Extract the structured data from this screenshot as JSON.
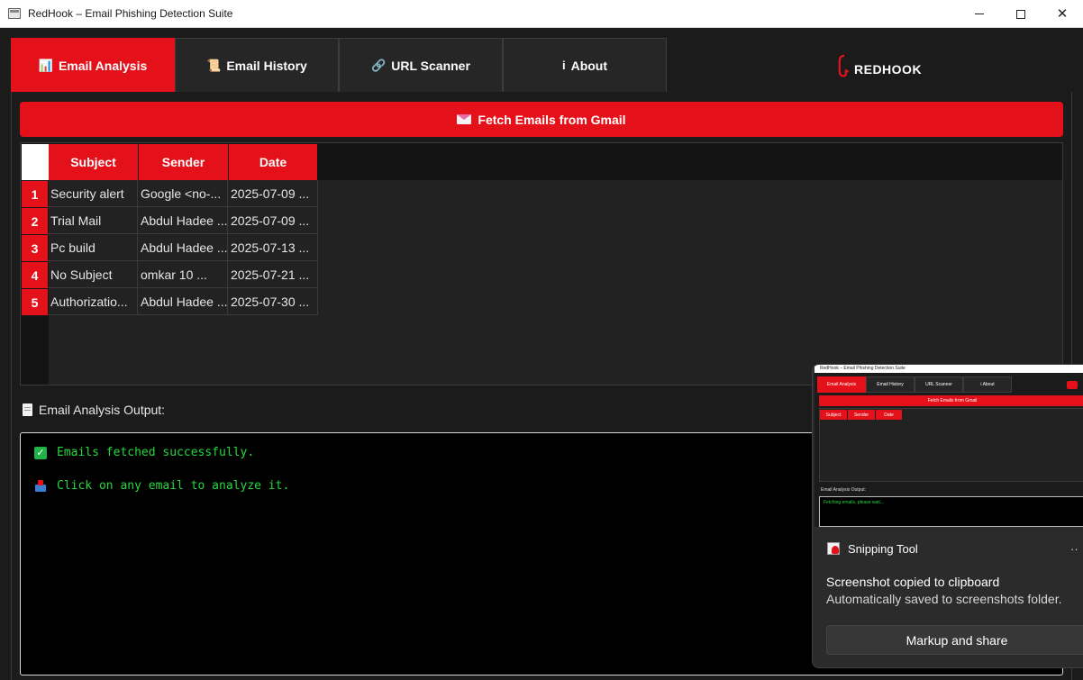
{
  "window": {
    "title": "RedHook – Email Phishing Detection Suite"
  },
  "tabs": [
    {
      "icon": "📊",
      "label": "Email Analysis"
    },
    {
      "icon": "📜",
      "label": "Email History"
    },
    {
      "icon": "🔗",
      "label": "URL Scanner"
    },
    {
      "icon": "i",
      "label": "About"
    }
  ],
  "brand": {
    "name": "REDHOOK"
  },
  "fetch": {
    "label": "Fetch Emails from Gmail"
  },
  "table": {
    "columns": [
      "Subject",
      "Sender",
      "Date"
    ],
    "rows": [
      {
        "num": "1",
        "subject": "Security alert",
        "sender": "Google <no-...",
        "date": "2025-07-09 ..."
      },
      {
        "num": "2",
        "subject": "Trial Mail",
        "sender": "Abdul Hadee ...",
        "date": "2025-07-09 ..."
      },
      {
        "num": "3",
        "subject": "Pc build",
        "sender": "Abdul Hadee ...",
        "date": "2025-07-13 ..."
      },
      {
        "num": "4",
        "subject": "No Subject",
        "sender": "omkar 10 ...",
        "date": "2025-07-21 ..."
      },
      {
        "num": "5",
        "subject": "Authorizatio...",
        "sender": "Abdul Hadee ...",
        "date": "2025-07-30 ..."
      }
    ]
  },
  "output": {
    "label": "Email Analysis Output:",
    "lines": [
      "Emails fetched successfully.",
      "Click on any email to analyze it."
    ]
  },
  "toast": {
    "app": "Snipping Tool",
    "title": "Screenshot copied to clipboard",
    "body": "Automatically saved to screenshots folder.",
    "button": "Markup and share",
    "thumbnail": {
      "title": "RedHook – Email Phishing Detection Suite",
      "tabs": [
        "Email Analysis",
        "Email History",
        "URL Scanner",
        "i About"
      ],
      "fetch": "Fetch Emails from Gmail",
      "columns": [
        "Subject",
        "Sender",
        "Date"
      ],
      "label": "Email Analysis Output:",
      "status": "Fetching emails, please wait..."
    }
  },
  "colors": {
    "accent": "#e5111a",
    "success_text": "#25d83f",
    "background": "#1b1b1b"
  }
}
